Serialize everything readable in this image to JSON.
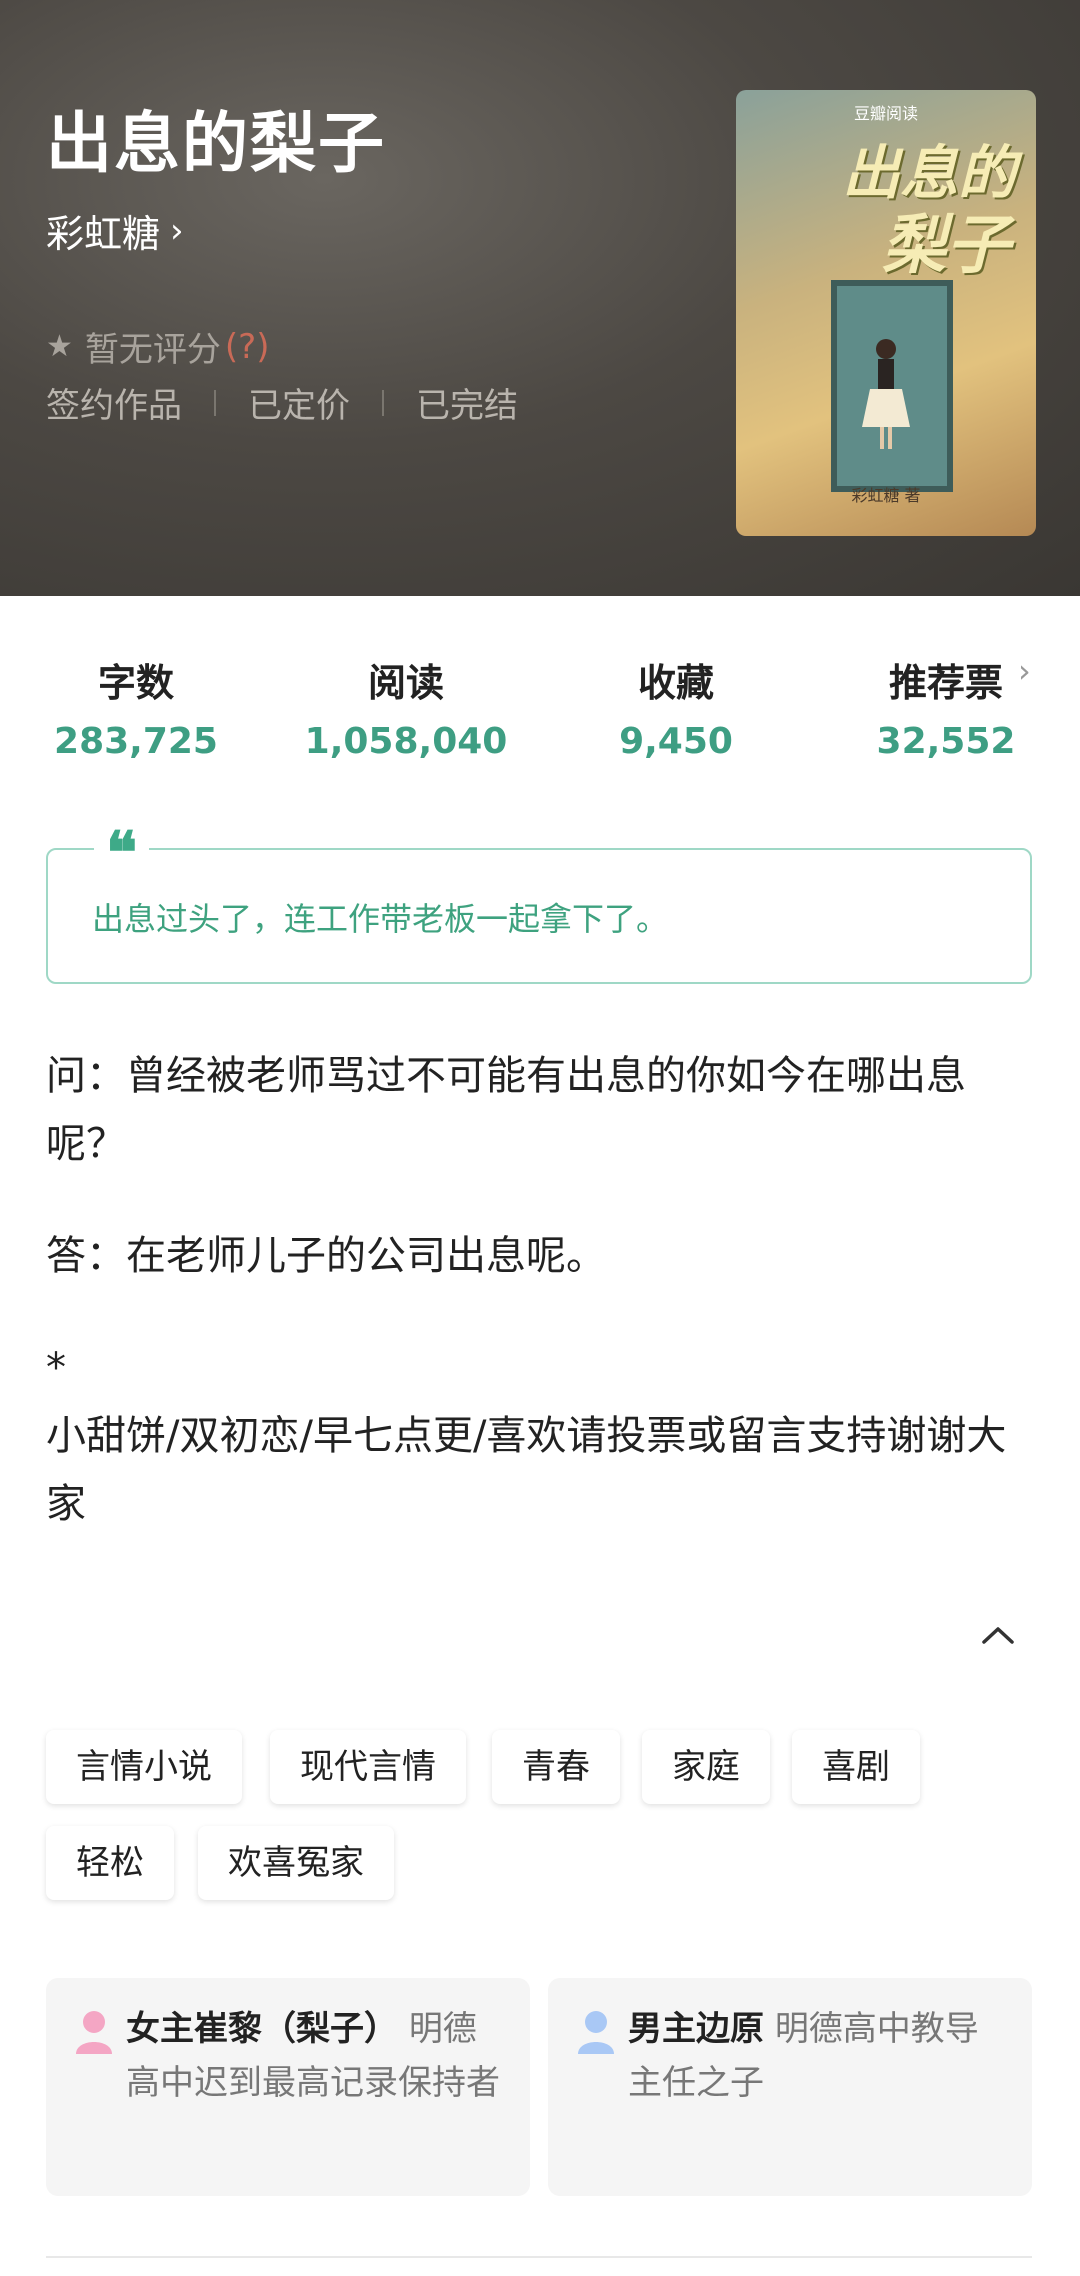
{
  "book": {
    "title": "出息的梨子",
    "author": "彩虹糖",
    "rating_text": "暂无评分",
    "rating_help": "(?)",
    "meta": [
      "签约作品",
      "已定价",
      "已完结"
    ]
  },
  "cover": {
    "brand": "豆瓣阅读",
    "title_line1": "出息的",
    "title_line2": "梨子",
    "author": "彩虹糖 著"
  },
  "stats": [
    {
      "label": "字数",
      "value": "283,725"
    },
    {
      "label": "阅读",
      "value": "1,058,040"
    },
    {
      "label": "收藏",
      "value": "9,450"
    },
    {
      "label": "推荐票",
      "value": "32,552"
    }
  ],
  "quote": {
    "mark": "❝",
    "text": "出息过头了，连工作带老板一起拿下了。"
  },
  "description": {
    "q": "问：曾经被老师骂过不可能有出息的你如今在哪出息呢？",
    "a": "答：在老师儿子的公司出息呢。",
    "star": "*",
    "note": "小甜饼/双初恋/早七点更/喜欢请投票或留言支持谢谢大家"
  },
  "tags": [
    "言情小说",
    "现代言情",
    "青春",
    "家庭",
    "喜剧",
    "轻松",
    "欢喜冤家"
  ],
  "characters": [
    {
      "name": "女主崔黎（梨子）",
      "desc": "明德高中迟到最高记录保持者",
      "color": "#f4a6c4"
    },
    {
      "name": "男主边原",
      "desc": "明德高中教导主任之子",
      "color": "#a9c8f5"
    }
  ],
  "icons": {
    "author_chevron": "chevron-right-icon",
    "star": "star-icon",
    "collapse": "chevron-up-icon",
    "stats_chevron": "chevron-right-icon",
    "character": "person-icon"
  },
  "colors": {
    "accent_green": "#3e9e83",
    "hero_bg": "#4c4843"
  }
}
